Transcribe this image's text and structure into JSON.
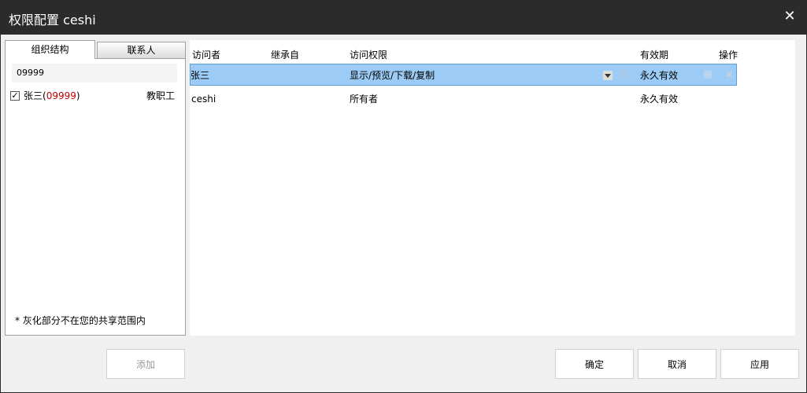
{
  "window": {
    "title": "权限配置 ceshi",
    "close_glyph": "✕"
  },
  "left": {
    "tabs": [
      "组织结构",
      "联系人"
    ],
    "search_value": "09999",
    "tree": {
      "checked": true,
      "check_glyph": "✓",
      "name": "张三",
      "paren_open": "(",
      "code": "09999",
      "paren_close": ")",
      "role": "教职工",
      "code_color": "#c00000"
    },
    "footnote": "* 灰化部分不在您的共享范围内"
  },
  "table": {
    "headers": {
      "visitor": "访问者",
      "inherit": "继承自",
      "permission": "访问权限",
      "validity": "有效期",
      "action": "操作"
    },
    "rows": [
      {
        "visitor": "张三",
        "inherit": "",
        "permission": "显示/预览/下载/复制",
        "validity": "永久有效",
        "selected": true
      },
      {
        "visitor": "ceshi",
        "inherit": "",
        "permission": "所有者",
        "validity": "永久有效",
        "selected": false
      }
    ],
    "icons": {
      "dropdown": "dropdown-arrow-icon",
      "settings": "gear-icon",
      "calendar": "calendar-icon",
      "delete": "delete-icon"
    },
    "selected_color": "#9ccbf5"
  },
  "buttons": {
    "add": "添加",
    "ok": "确定",
    "cancel": "取消",
    "apply": "应用"
  }
}
